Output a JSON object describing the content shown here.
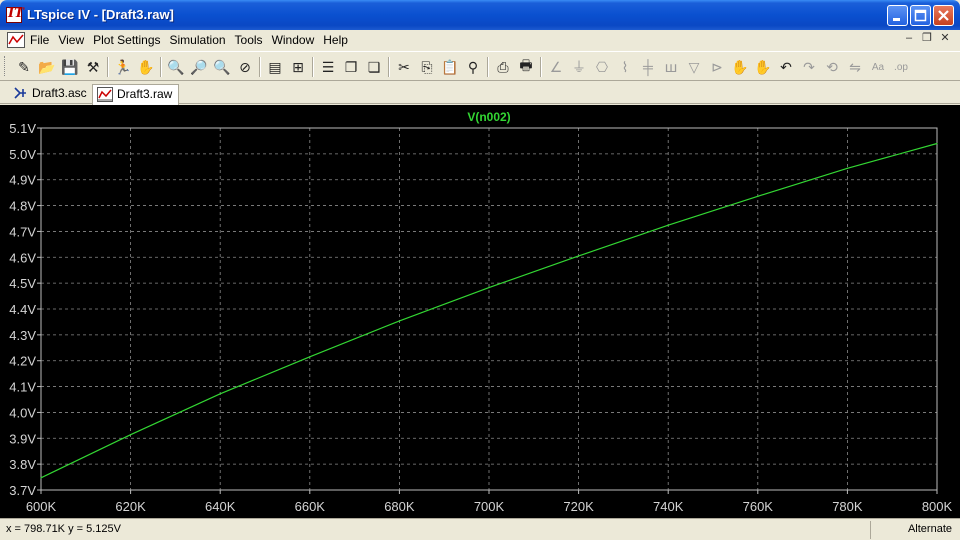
{
  "window": {
    "title": "LTspice IV - [Draft3.raw]",
    "app_icon": "ltspice-logo-icon",
    "controls": [
      "minimize-icon",
      "maximize-icon",
      "close-icon"
    ]
  },
  "menu": {
    "items": [
      {
        "label": "File"
      },
      {
        "label": "View"
      },
      {
        "label": "Plot Settings"
      },
      {
        "label": "Simulation"
      },
      {
        "label": "Tools"
      },
      {
        "label": "Window"
      },
      {
        "label": "Help"
      }
    ],
    "mdi_controls": [
      "mdi-minimize-icon",
      "mdi-restore-icon",
      "mdi-close-icon"
    ]
  },
  "toolbar": {
    "buttons": [
      {
        "icon": "new-schematic-icon",
        "glyph": "✎",
        "enabled": true
      },
      {
        "icon": "open-icon",
        "glyph": "📂",
        "enabled": true
      },
      {
        "icon": "save-icon",
        "glyph": "💾",
        "enabled": true
      },
      {
        "icon": "control-panel-icon",
        "glyph": "⚒",
        "enabled": true
      },
      {
        "icon": "run-icon",
        "glyph": "🏃",
        "enabled": true
      },
      {
        "icon": "halt-icon",
        "glyph": "✋",
        "enabled": false
      },
      {
        "icon": "zoom-in-icon",
        "glyph": "🔍",
        "enabled": true
      },
      {
        "icon": "zoom-pan-icon",
        "glyph": "🔎",
        "enabled": true
      },
      {
        "icon": "zoom-out-icon",
        "glyph": "🔍",
        "enabled": true
      },
      {
        "icon": "zoom-fit-icon",
        "glyph": "⊘",
        "enabled": true
      },
      {
        "icon": "autorange-icon",
        "glyph": "▤",
        "enabled": true
      },
      {
        "icon": "pick-traces-icon",
        "glyph": "⊞",
        "enabled": true
      },
      {
        "icon": "tile-horizontal-icon",
        "glyph": "☰",
        "enabled": true
      },
      {
        "icon": "cascade-icon",
        "glyph": "❐",
        "enabled": true
      },
      {
        "icon": "tile-vertical-icon",
        "glyph": "❏",
        "enabled": true
      },
      {
        "icon": "cut-icon",
        "glyph": "✂",
        "enabled": true
      },
      {
        "icon": "copy-icon",
        "glyph": "⎘",
        "enabled": true
      },
      {
        "icon": "paste-icon",
        "glyph": "📋",
        "enabled": true
      },
      {
        "icon": "find-icon",
        "glyph": "⚲",
        "enabled": true
      },
      {
        "icon": "print-setup-icon",
        "glyph": "⎙",
        "enabled": true
      },
      {
        "icon": "print-icon",
        "glyph": "🖶",
        "enabled": true
      },
      {
        "icon": "wire-icon",
        "glyph": "∠",
        "enabled": false
      },
      {
        "icon": "ground-icon",
        "glyph": "⏚",
        "enabled": false
      },
      {
        "icon": "label-net-icon",
        "glyph": "⎔",
        "enabled": false
      },
      {
        "icon": "resistor-icon",
        "glyph": "⌇",
        "enabled": false
      },
      {
        "icon": "capacitor-icon",
        "glyph": "╪",
        "enabled": false
      },
      {
        "icon": "inductor-icon",
        "glyph": "ꟺ",
        "enabled": false
      },
      {
        "icon": "diode-icon",
        "glyph": "▽",
        "enabled": false
      },
      {
        "icon": "component-icon",
        "glyph": "⊳",
        "enabled": false
      },
      {
        "icon": "move-icon",
        "glyph": "✋",
        "enabled": false
      },
      {
        "icon": "drag-icon",
        "glyph": "✋",
        "enabled": false
      },
      {
        "icon": "undo-icon",
        "glyph": "↶",
        "enabled": true
      },
      {
        "icon": "redo-icon",
        "glyph": "↷",
        "enabled": false
      },
      {
        "icon": "rotate-icon",
        "glyph": "⟲",
        "enabled": false
      },
      {
        "icon": "mirror-icon",
        "glyph": "⇋",
        "enabled": false
      },
      {
        "icon": "text-icon",
        "glyph": "Aa",
        "enabled": false
      },
      {
        "icon": "spice-directive-icon",
        "glyph": ".op",
        "enabled": false
      }
    ]
  },
  "tabs": [
    {
      "label": "Draft3.asc",
      "icon": "schematic-icon",
      "active": false
    },
    {
      "label": "Draft3.raw",
      "icon": "waveform-icon",
      "active": true
    }
  ],
  "chart_data": {
    "type": "line",
    "title": "V(n002)",
    "xlabel": "",
    "ylabel": "",
    "xlim": [
      600000,
      800000
    ],
    "ylim": [
      3.7,
      5.1
    ],
    "x_ticks": [
      "600K",
      "620K",
      "640K",
      "660K",
      "680K",
      "700K",
      "720K",
      "740K",
      "760K",
      "780K",
      "800K"
    ],
    "y_ticks": [
      "3.7V",
      "3.8V",
      "3.9V",
      "4.0V",
      "4.1V",
      "4.2V",
      "4.3V",
      "4.4V",
      "4.5V",
      "4.6V",
      "4.7V",
      "4.8V",
      "4.9V",
      "5.0V",
      "5.1V"
    ],
    "grid": true,
    "background_color": "#000000",
    "trace_color": "#33d633",
    "series": [
      {
        "name": "V(n002)",
        "x": [
          600000,
          620000,
          640000,
          660000,
          680000,
          700000,
          720000,
          740000,
          760000,
          780000,
          800000
        ],
        "y": [
          3.747,
          3.914,
          4.072,
          4.215,
          4.354,
          4.483,
          4.605,
          4.724,
          4.836,
          4.944,
          5.04
        ]
      }
    ]
  },
  "status": {
    "cursor": "x = 798.71K    y = 5.125V",
    "mode": "Alternate"
  }
}
